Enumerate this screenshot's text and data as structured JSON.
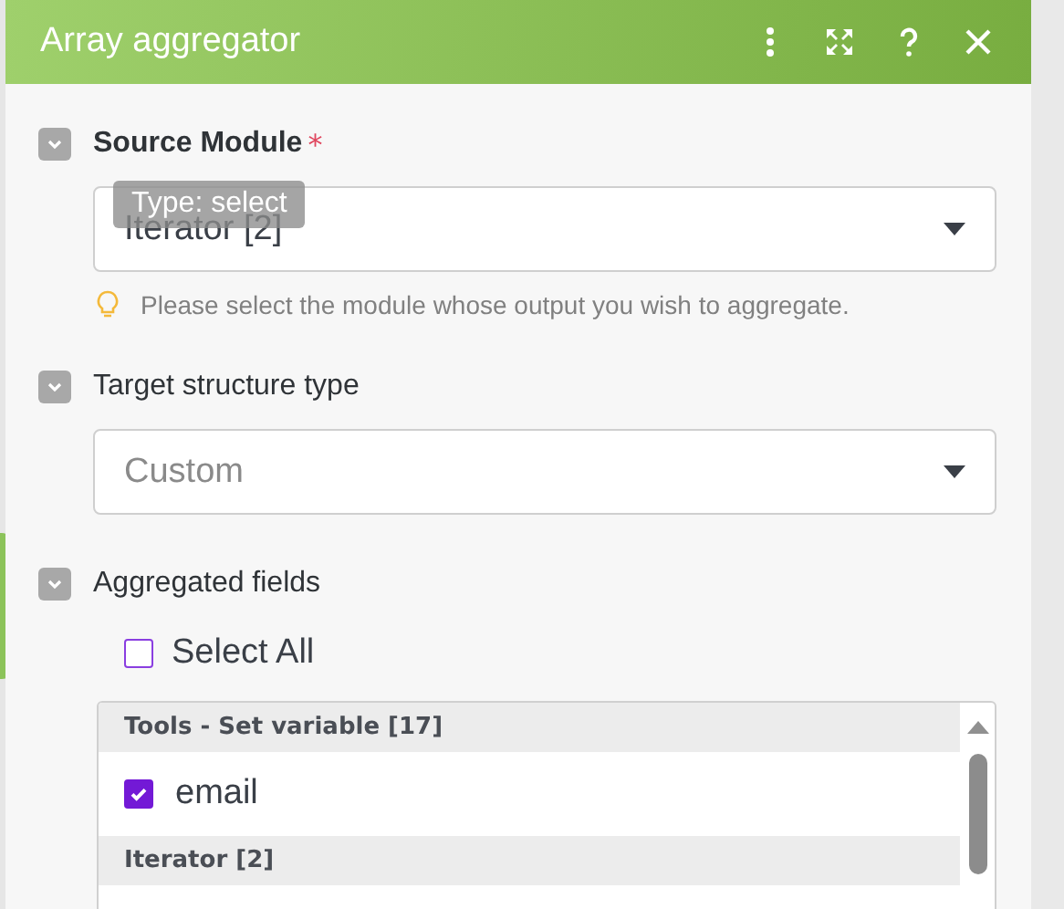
{
  "window": {
    "title": "Array aggregator"
  },
  "sections": [
    {
      "kind": "select",
      "label": "Source Module",
      "required_mark": "*",
      "expanded": true,
      "value": "Iterator [2]",
      "placeholder_style": false,
      "tooltip": "Type: select",
      "hint": "Please select the module whose output you wish to aggregate."
    },
    {
      "kind": "select",
      "label": "Target structure type",
      "expanded": true,
      "value": "Custom",
      "placeholder_style": true
    },
    {
      "kind": "fields",
      "label": "Aggregated fields",
      "expanded": true,
      "select_all": {
        "label": "Select All",
        "checked": false
      },
      "groups": [
        {
          "title": "Tools - Set variable [17]",
          "items": [
            {
              "label": "email",
              "checked": true
            }
          ]
        },
        {
          "title": "Iterator [2]"
        }
      ]
    }
  ]
}
